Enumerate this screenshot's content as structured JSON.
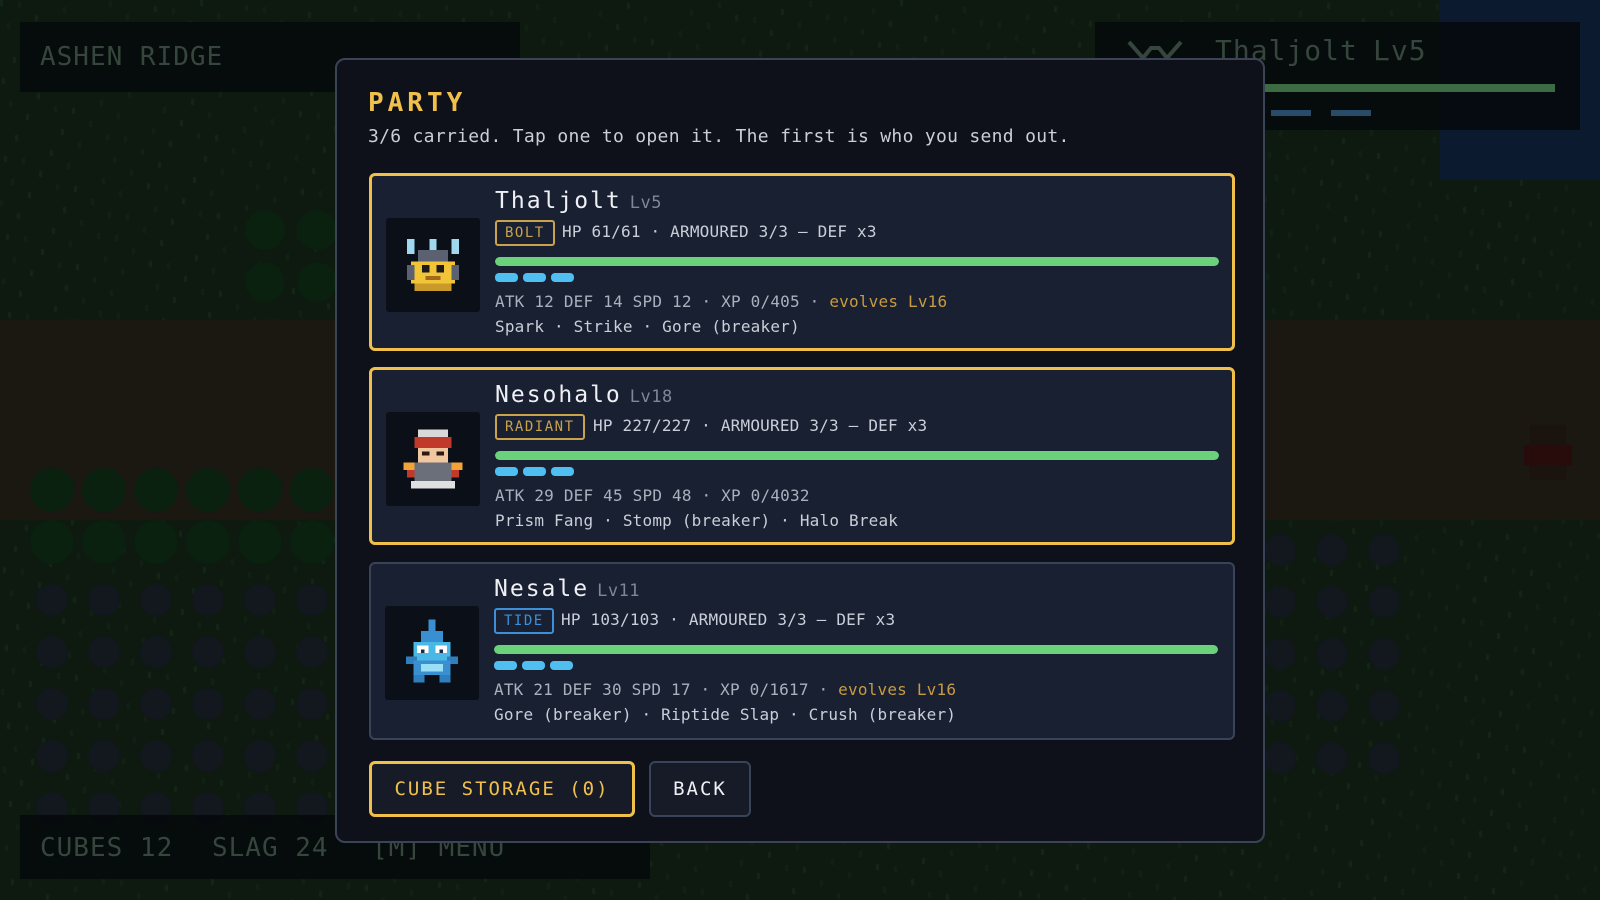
{
  "hud": {
    "area_name": "ASHEN RIDGE",
    "foe_name": "Thaljolt",
    "foe_level": "Lv5",
    "currency": {
      "cubes": "CUBES 12",
      "slag": "SLAG 24",
      "menu_hint": "[M] MENU"
    }
  },
  "party": {
    "title": "PARTY",
    "subtitle": "3/6 carried. Tap one to open it. The first is who you send out.",
    "members": [
      {
        "name": "Thaljolt",
        "level": "Lv5",
        "type": "BOLT",
        "type_color": "#c9a24a",
        "hp_text": "HP 61/61 · ARMOURED 3/3 — DEF x3",
        "hp_fraction": 1.0,
        "armour_pips": 3,
        "stats": "ATK 12 DEF 14 SPD 12 · XP 0/405 · ",
        "evolve": "evolves Lv16",
        "moves": "Spark · Strike · Gore (breaker)",
        "highlight": true,
        "sprite_icon": "bolt-creature-icon"
      },
      {
        "name": "Nesohalo",
        "level": "Lv18",
        "type": "RADIANT",
        "type_color": "#c9a24a",
        "hp_text": "HP 227/227 · ARMOURED 3/3 — DEF x3",
        "hp_fraction": 1.0,
        "armour_pips": 3,
        "stats": "ATK 29 DEF 45 SPD 48 · XP 0/4032",
        "evolve": "",
        "moves": "Prism Fang · Stomp (breaker) · Halo Break",
        "highlight": true,
        "sprite_icon": "radiant-creature-icon"
      },
      {
        "name": "Nesale",
        "level": "Lv11",
        "type": "TIDE",
        "type_color": "#3d8fd6",
        "hp_text": "HP 103/103 · ARMOURED 3/3 — DEF x3",
        "hp_fraction": 1.0,
        "armour_pips": 3,
        "stats": "ATK 21 DEF 30 SPD 17 · XP 0/1617 · ",
        "evolve": "evolves Lv16",
        "moves": "Gore (breaker) · Riptide Slap · Crush (breaker)",
        "highlight": false,
        "sprite_icon": "tide-creature-icon"
      }
    ],
    "buttons": {
      "cube_storage": "CUBE STORAGE (0)",
      "back": "BACK"
    }
  },
  "colors": {
    "accent_gold": "#f0c04a",
    "hp_green": "#6ad27a",
    "armour_blue": "#4ebff0",
    "panel_bg": "#0e1119",
    "card_bg": "#182032"
  }
}
